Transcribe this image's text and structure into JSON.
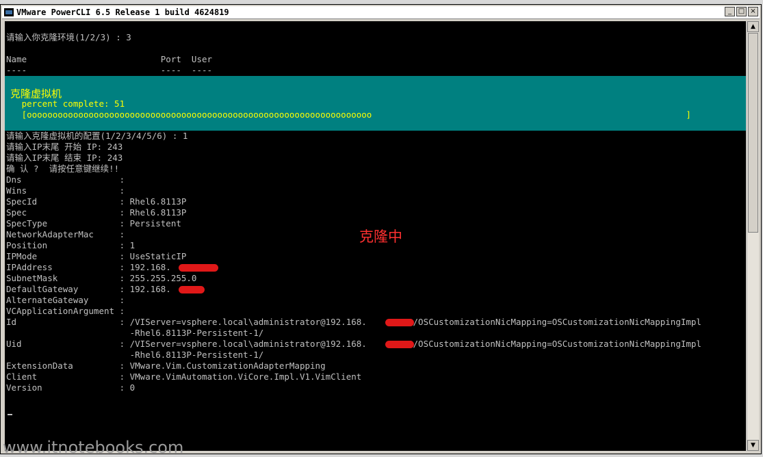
{
  "window": {
    "title": "VMware PowerCLI 6.5 Release 1 build 4624819",
    "buttons": [
      "_",
      "□",
      "×"
    ]
  },
  "console": {
    "lines_top": [
      "请输入你克隆环境(1/2/3) : 3",
      "",
      "Name                          Port  User",
      "----                          ----  ----"
    ],
    "progress": {
      "activity": "克隆虚拟机",
      "status": "   percent complete: 51",
      "bar": "   [ooooooooooooooooooooooooooooooooooooooooooooooooooooooooooooooooooo                                                             ]",
      "percent": 51
    },
    "lines_bottom": [
      "请输入克隆虚拟机的配置(1/2/3/4/5/6) : 1",
      "请输入IP末尾 开始 IP: 243",
      "请输入IP末尾 结束 IP: 243",
      "确 认 ?  请按任意键继续!!",
      "Dns                   :",
      "Wins                  :",
      "SpecId                : Rhel6.8113P",
      "Spec                  : Rhel6.8113P",
      "SpecType              : Persistent",
      "NetworkAdapterMac     :",
      "Position              : 1",
      "IPMode                : UseStaticIP",
      "IPAddress             : 192.168.",
      "SubnetMask            : 255.255.255.0",
      "DefaultGateway        : 192.168.",
      "AlternateGateway      :",
      "VCApplicationArgument :",
      "Id                    : /VIServer=vsphere.local\\administrator@192.168.     :443/OSCustomizationNicMapping=OSCustomizationNicMappingImpl",
      "                        -Rhel6.8113P-Persistent-1/",
      "Uid                   : /VIServer=vsphere.local\\administrator@192.168.     :443/OSCustomizationNicMapping=OSCustomizationNicMappingImpl",
      "                        -Rhel6.8113P-Persistent-1/",
      "ExtensionData         : VMware.Vim.CustomizationAdapterMapping",
      "Client                : VMware.VimAutomation.ViCore.Impl.V1.VimClient",
      "Version               : 0"
    ]
  },
  "overlay_label": "克隆中",
  "watermark": "www.itnotebooks.com",
  "colors": {
    "console_bg": "#000000",
    "console_text": "#c0c0c0",
    "progress_bg": "#008080",
    "progress_text": "#ffff00",
    "annotation": "#ff3030",
    "redaction": "#e01818"
  }
}
